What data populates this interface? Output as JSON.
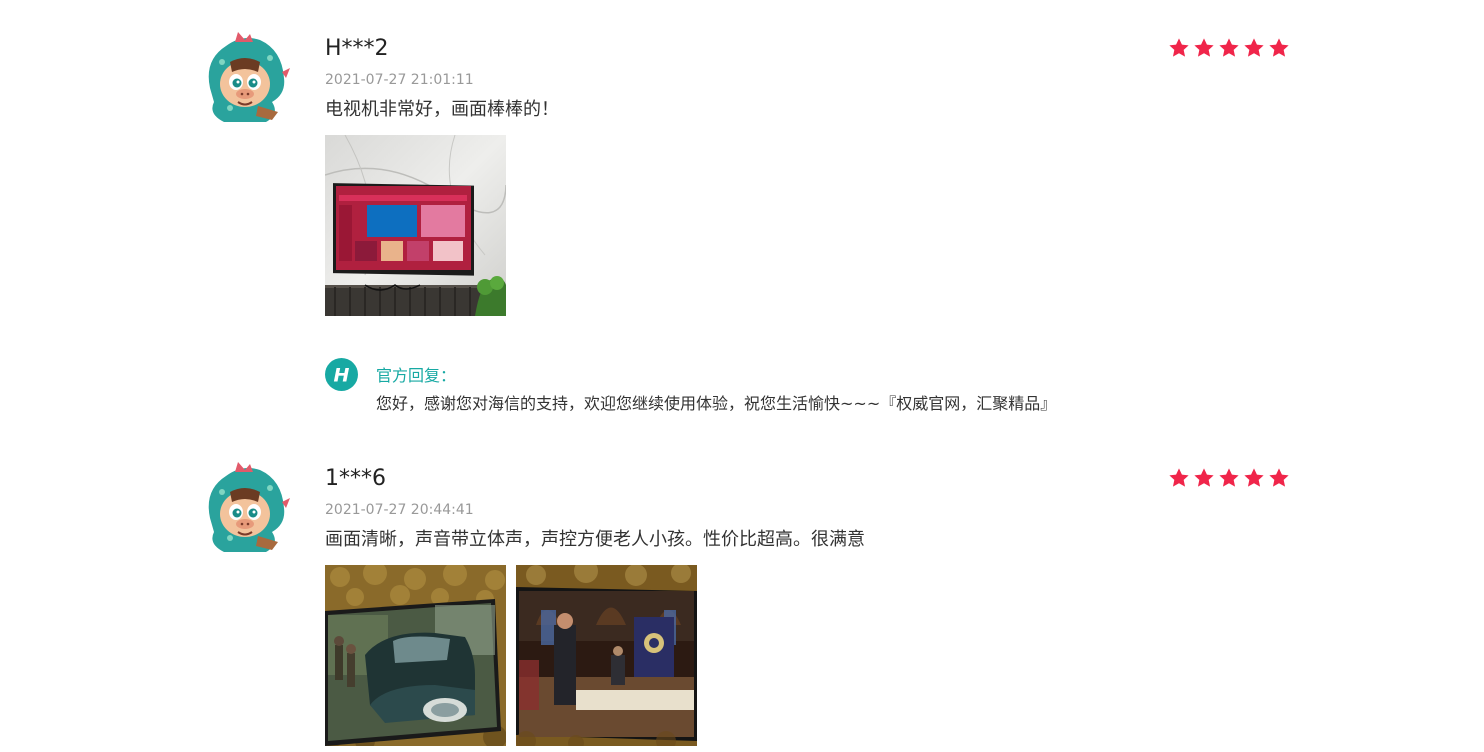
{
  "accent_color": "#f0254a",
  "reply_color": "#17a9a3",
  "reviews": [
    {
      "username": "H***2",
      "date": "2021-07-27 21:01:11",
      "rating": 5,
      "content": "电视机非常好，画面棒棒的！",
      "photos": [
        "tv-wall-photo"
      ],
      "official_reply": {
        "label": "官方回复：",
        "text": "您好，感谢您对海信的支持，欢迎您继续使用体验，祝您生活愉快~~~『权威官网，汇聚精品』"
      }
    },
    {
      "username": "1***6",
      "date": "2021-07-27 20:44:41",
      "rating": 5,
      "content": "画面清晰，声音带立体声，声控方便老人小孩。性价比超高。很满意",
      "photos": [
        "tv-car-scene-photo",
        "tv-meeting-scene-photo"
      ]
    }
  ],
  "reply_logo_letter": "H"
}
